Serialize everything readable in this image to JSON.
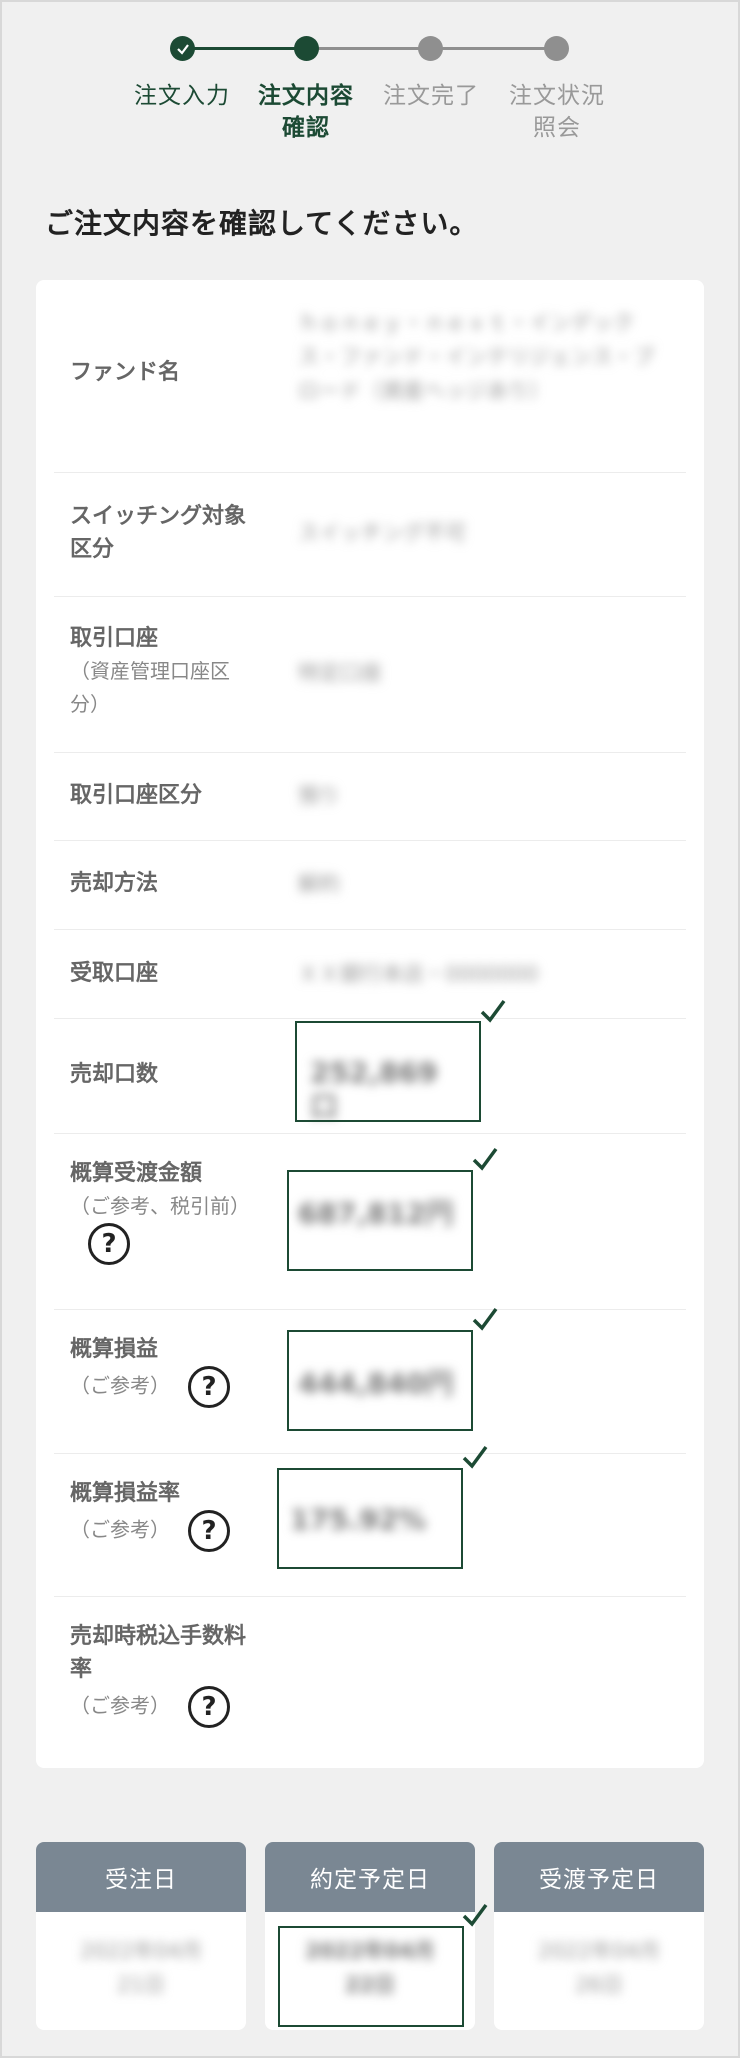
{
  "stepper": {
    "steps": [
      {
        "label": "注文入力",
        "state": "done"
      },
      {
        "label": "注文内容確認",
        "state": "current"
      },
      {
        "label": "注文完了",
        "state": "upcoming"
      },
      {
        "label": "注文状況照会",
        "state": "upcoming"
      }
    ],
    "colors": {
      "active": "#1c4a34",
      "inactive": "#8f8f8f"
    }
  },
  "heading": "ご注文内容を確認してください。",
  "details": {
    "fund_name": {
      "label": "ファンド名",
      "value": "ｈｏｎｅｙ・ｎｅｘｔ・インデックス・ファンド・インテリジェンス・ブロード（資産ヘッジあり）"
    },
    "switching": {
      "label": "スイッチング対象区分",
      "value": "スイッチング不可"
    },
    "account": {
      "label": "取引口座",
      "sub": "（資産管理口座区分）",
      "value": "特定口座"
    },
    "account_type": {
      "label": "取引口座区分",
      "value": "預り"
    },
    "sell_method": {
      "label": "売却方法",
      "value": "解約"
    },
    "receive_account": {
      "label": "受取口座",
      "value": "ＸＸ銀行本店・0000000"
    },
    "sell_units": {
      "label": "売却口数",
      "value": "252,869 口"
    },
    "delivery_amount": {
      "label": "概算受渡金額",
      "sub": "（ご参考、税引前）",
      "value": "687,812円"
    },
    "profit": {
      "label": "概算損益",
      "sub": "（ご参考）",
      "value": "444,840円"
    },
    "profit_rate": {
      "label": "概算損益率",
      "sub": "（ご参考）",
      "value": "175.92%"
    },
    "fee_rate": {
      "label": "売却時税込手数料率",
      "sub": "（ご参考）",
      "value": ""
    }
  },
  "dates": [
    {
      "label": "受注日",
      "value": "2022年04月21日"
    },
    {
      "label": "約定予定日",
      "value": "2022年04月22日"
    },
    {
      "label": "受渡予定日",
      "value": "2022年04月26日"
    }
  ]
}
